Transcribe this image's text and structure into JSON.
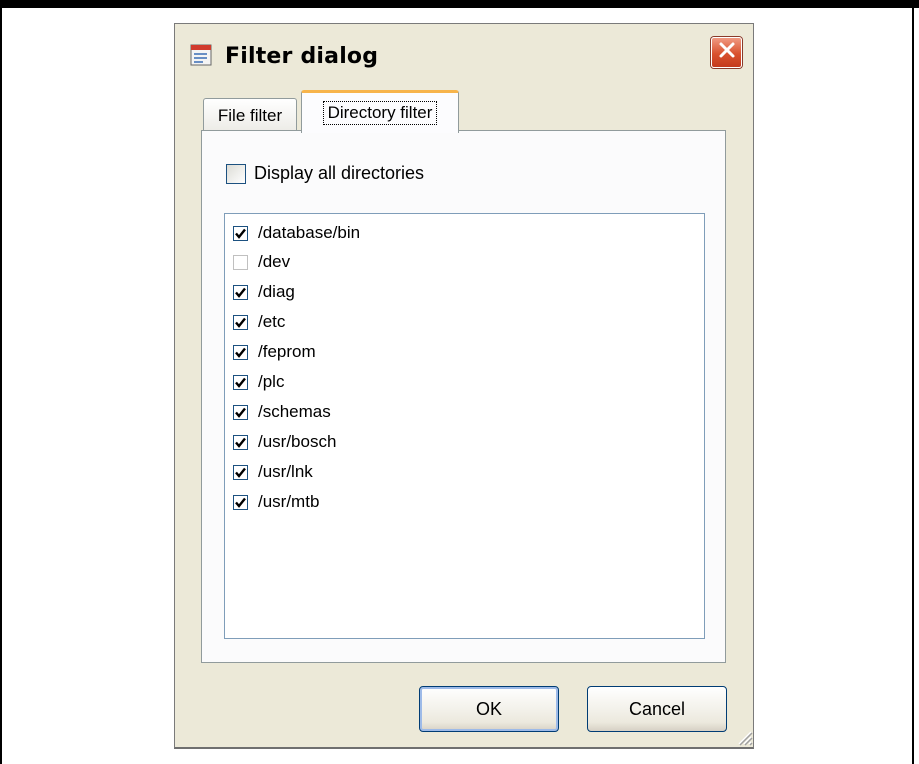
{
  "dialog": {
    "title": "Filter dialog",
    "close_icon": "close-icon"
  },
  "tabs": [
    {
      "label": "File filter",
      "active": false
    },
    {
      "label": "Directory filter",
      "active": true
    }
  ],
  "display_all": {
    "label": "Display all directories",
    "checked": false
  },
  "directories": [
    {
      "path": "/database/bin",
      "checked": true
    },
    {
      "path": "/dev",
      "checked": false
    },
    {
      "path": "/diag",
      "checked": true
    },
    {
      "path": "/etc",
      "checked": true
    },
    {
      "path": "/feprom",
      "checked": true
    },
    {
      "path": "/plc",
      "checked": true
    },
    {
      "path": "/schemas",
      "checked": true
    },
    {
      "path": "/usr/bosch",
      "checked": true
    },
    {
      "path": "/usr/lnk",
      "checked": true
    },
    {
      "path": "/usr/mtb",
      "checked": true
    }
  ],
  "buttons": {
    "ok": "OK",
    "cancel": "Cancel"
  },
  "colors": {
    "close_button": "#d9512e",
    "active_tab_accent": "#f7b44b",
    "dialog_bg": "#ece9d8"
  }
}
